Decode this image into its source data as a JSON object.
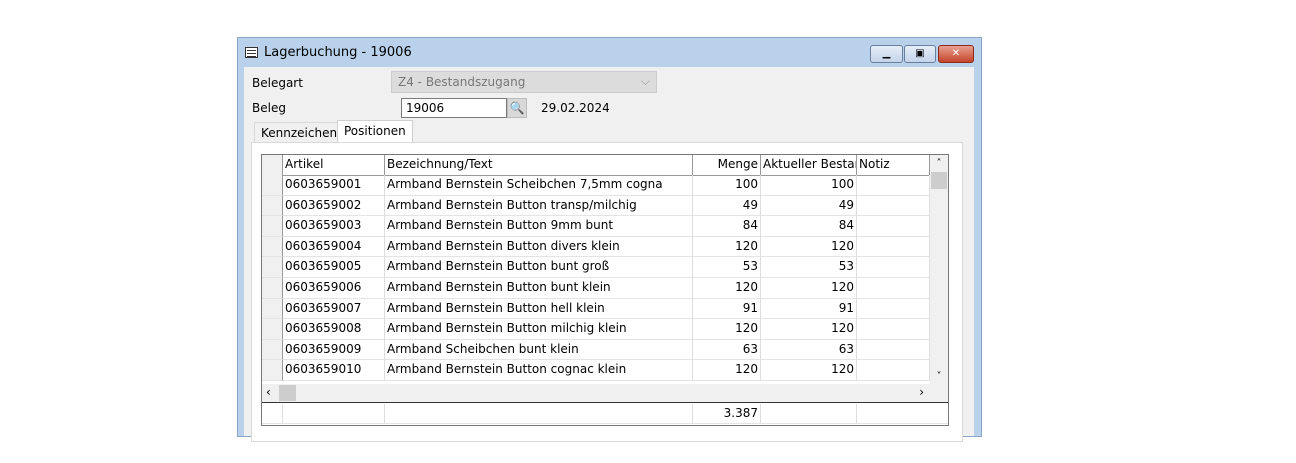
{
  "window": {
    "title": "Lagerbuchung - 19006"
  },
  "form": {
    "belegart_label": "Belegart",
    "belegart_value": "Z4 - Bestandszugang",
    "beleg_label": "Beleg",
    "beleg_value": "19006",
    "date": "29.02.2024"
  },
  "tabs": [
    {
      "label": "Kennzeichen",
      "active": false
    },
    {
      "label": "Positionen",
      "active": true
    }
  ],
  "grid": {
    "columns": [
      "Artikel",
      "Bezeichnung/Text",
      "Menge",
      "Aktueller Bestand",
      "Notiz"
    ],
    "rows": [
      [
        "0603659001",
        "Armband Bernstein Scheibchen 7,5mm cogna",
        "100",
        "100",
        ""
      ],
      [
        "0603659002",
        "Armband Bernstein Button transp/milchig",
        "49",
        "49",
        ""
      ],
      [
        "0603659003",
        "Armband Bernstein Button 9mm bunt",
        "84",
        "84",
        ""
      ],
      [
        "0603659004",
        "Armband Bernstein Button divers klein",
        "120",
        "120",
        ""
      ],
      [
        "0603659005",
        "Armband Bernstein Button bunt groß",
        "53",
        "53",
        ""
      ],
      [
        "0603659006",
        "Armband Bernstein Button bunt klein",
        "120",
        "120",
        ""
      ],
      [
        "0603659007",
        "Armband Bernstein Button hell klein",
        "91",
        "91",
        ""
      ],
      [
        "0603659008",
        "Armband Bernstein Button milchig klein",
        "120",
        "120",
        ""
      ],
      [
        "0603659009",
        "Armband Scheibchen bunt klein",
        "63",
        "63",
        ""
      ],
      [
        "0603659010",
        "Armband Bernstein Button cognac klein",
        "120",
        "120",
        ""
      ]
    ],
    "footer_total": "3.387"
  }
}
